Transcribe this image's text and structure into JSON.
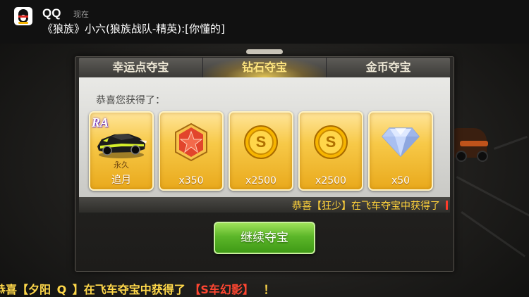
{
  "notification": {
    "app_name": "QQ",
    "time": "现在",
    "message": "《狼族》小六(狼族战队-精英):[你懂的]"
  },
  "tabs": [
    {
      "label": "幸运点夺宝",
      "active": false
    },
    {
      "label": "钻石夺宝",
      "active": true
    },
    {
      "label": "金币夺宝",
      "active": false
    }
  ],
  "congrats_text": "恭喜您获得了：",
  "rewards": [
    {
      "icon": "race-car-icon",
      "badge": "RA",
      "sub": "永久",
      "label": "追月"
    },
    {
      "icon": "red-star-medal-icon",
      "label": "x350"
    },
    {
      "icon": "gold-coin-icon",
      "label": "x2500"
    },
    {
      "icon": "gold-coin-icon",
      "label": "x2500"
    },
    {
      "icon": "diamond-icon",
      "label": "x50"
    }
  ],
  "ticker": "恭喜【狂少】在飞车夺宝中获得了",
  "continue_button": "继续夺宝",
  "bottom_ticker": {
    "part1": "恭喜【夕阳",
    "part2": "Q",
    "part3": "】在飞车夺宝中获得了",
    "item": "【S车幻影】",
    "end": "！"
  },
  "colors": {
    "tab_active": "#ffe680",
    "card_gold": "#f7c948",
    "button_green": "#5cb629",
    "ticker_yellow": "#ffd23a",
    "highlight_red": "#ff4631"
  }
}
